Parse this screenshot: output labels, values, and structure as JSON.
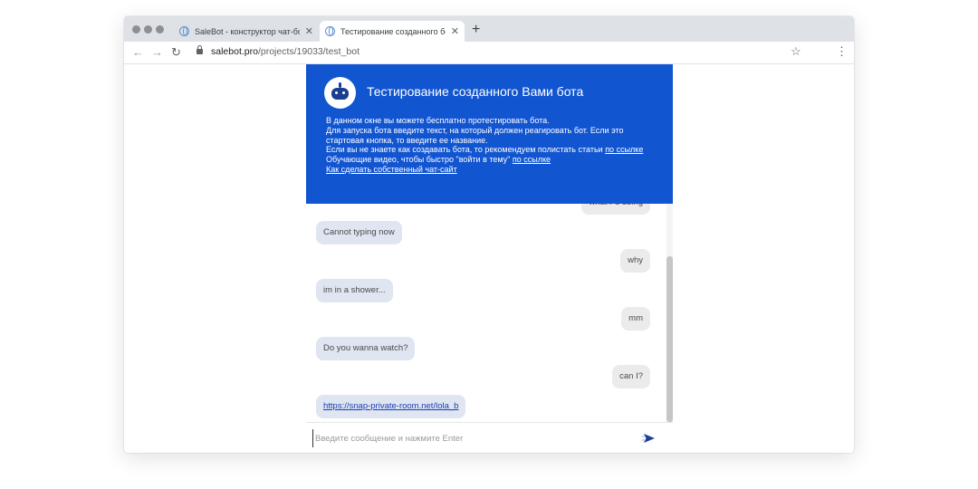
{
  "browser": {
    "tabs": [
      {
        "title": "SaleBot - конструктор чат-бо",
        "close": "✕",
        "active": false
      },
      {
        "title": "Тестирование созданного бо",
        "close": "✕",
        "active": true
      }
    ],
    "new_tab": "+",
    "url_host": "salebot.pro",
    "url_path": "/projects/19033/test_bot",
    "icons": {
      "back": "arrow-left-icon",
      "forward": "arrow-right-icon",
      "reload": "reload-icon",
      "lock": "lock-icon",
      "star": "star-icon",
      "menu": "kebab-menu-icon"
    }
  },
  "widget": {
    "title": "Тестирование созданного Вами бота",
    "intro_lines": [
      "В данном окне вы можете бесплатно протестировать бота.",
      "Для запуска бота введите текст, на который должен реагировать бот. Если это стартовая кнопка, то введите ее название."
    ],
    "articles_text": "Если вы не знаете как создавать бота, то рекомендуем полистать статьи",
    "articles_link": "по ссылке",
    "video_text": "Обучающие видео, чтобы быстро \"войти в тему\"",
    "video_link": "по ссылке",
    "site_link": "Как сделать собственный чат-сайт",
    "accent_color": "#1255d1"
  },
  "messages": [
    {
      "from": "user",
      "text": "what r u doing"
    },
    {
      "from": "bot",
      "text": "Cannot typing now"
    },
    {
      "from": "user",
      "text": "why"
    },
    {
      "from": "bot",
      "text": "im in a shower..."
    },
    {
      "from": "user",
      "text": "mm"
    },
    {
      "from": "bot",
      "text": "Do you wanna watch?"
    },
    {
      "from": "user",
      "text": "can I?"
    },
    {
      "from": "bot",
      "text": "https://snap-private-room.net/lola_b",
      "link": true
    }
  ],
  "composer": {
    "placeholder": "Введите сообщение и нажмите Enter",
    "value": ""
  }
}
